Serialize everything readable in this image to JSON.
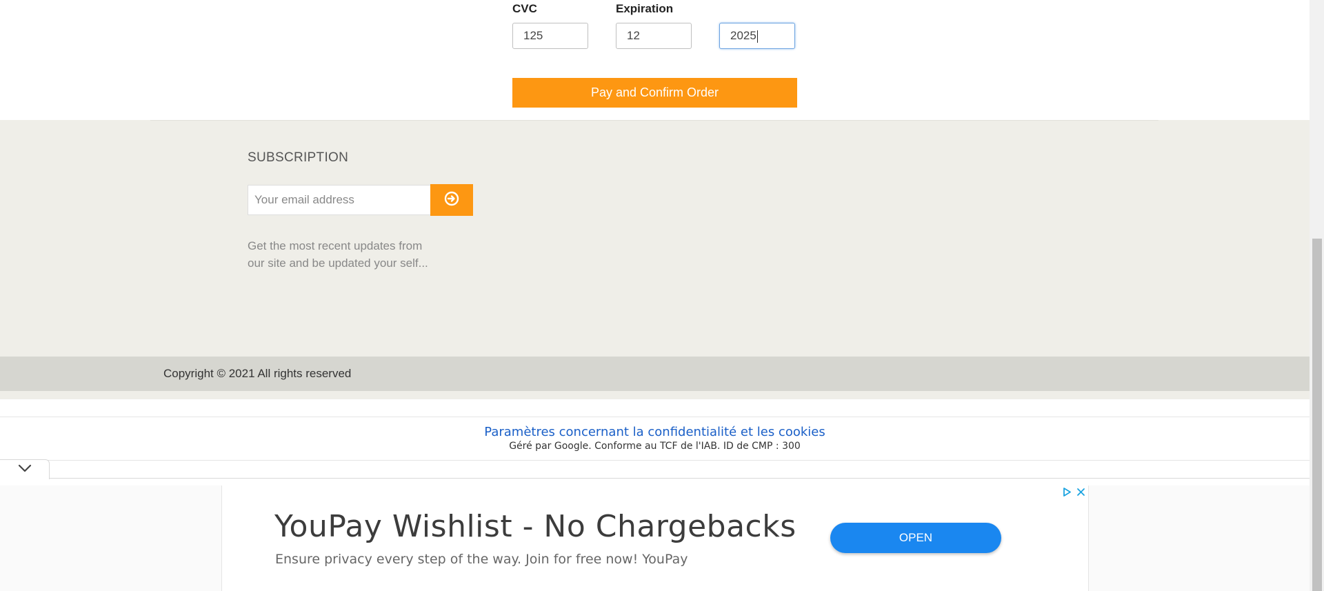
{
  "payment": {
    "cvc_label": "CVC",
    "cvc_value": "125",
    "expiration_label": "Expiration",
    "exp_month_value": "12",
    "exp_year_value": "2025",
    "pay_button_label": "Pay and Confirm Order"
  },
  "subscription": {
    "title": "SUBSCRIPTION",
    "email_placeholder": "Your email address",
    "submit_icon": "arrow-circle-right-icon",
    "description_line1": "Get the most recent updates from",
    "description_line2": "our site and be updated your self..."
  },
  "footer": {
    "copyright": "Copyright © 2021 All rights reserved"
  },
  "consent": {
    "link_text": "Paramètres concernant la confidentialité et les cookies",
    "sub_text": "Géré par Google. Conforme au TCF de l'IAB. ID de CMP : 300"
  },
  "ad": {
    "title": "YouPay Wishlist - No Chargebacks",
    "description": "Ensure privacy every step of the way. Join for free now! YouPay",
    "open_label": "OPEN",
    "adchoices_icon": "adchoices-icon",
    "close_icon": "close-icon"
  },
  "colors": {
    "accent": "#fd9712",
    "subscription_bg": "#efeee8",
    "copyright_bg": "#d6d6d0",
    "consent_link": "#1a5fc7",
    "ad_button": "#1a87f0"
  }
}
